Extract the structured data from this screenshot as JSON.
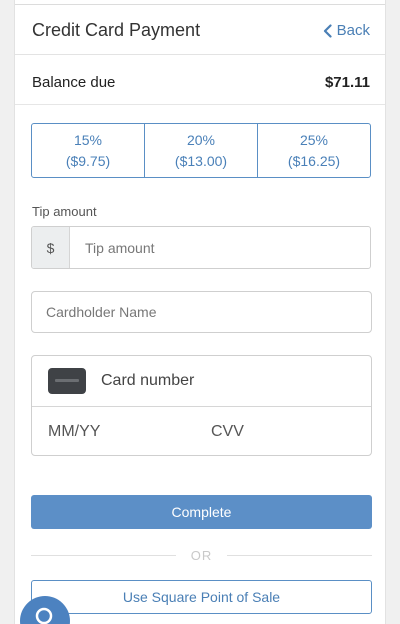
{
  "header": {
    "title": "Credit Card Payment",
    "back_label": "Back"
  },
  "balance": {
    "label": "Balance due",
    "amount": "$71.11"
  },
  "tips": [
    {
      "percent": "15%",
      "amount": "($9.75)"
    },
    {
      "percent": "20%",
      "amount": "($13.00)"
    },
    {
      "percent": "25%",
      "amount": "($16.25)"
    }
  ],
  "tip_amount": {
    "label": "Tip amount",
    "prefix": "$",
    "placeholder": "Tip amount"
  },
  "cardholder": {
    "placeholder": "Cardholder Name"
  },
  "card": {
    "number_placeholder": "Card number",
    "expiry_placeholder": "MM/YY",
    "cvv_placeholder": "CVV"
  },
  "actions": {
    "complete_label": "Complete",
    "or_label": "OR",
    "square_label": "Use Square Point of Sale"
  },
  "colors": {
    "accent": "#5c8fc7",
    "link": "#4a7fb5",
    "fab": "#4c82c0"
  },
  "icons": {
    "back": "chevron-left-icon",
    "card": "credit-card-icon",
    "fab": "search-icon"
  }
}
